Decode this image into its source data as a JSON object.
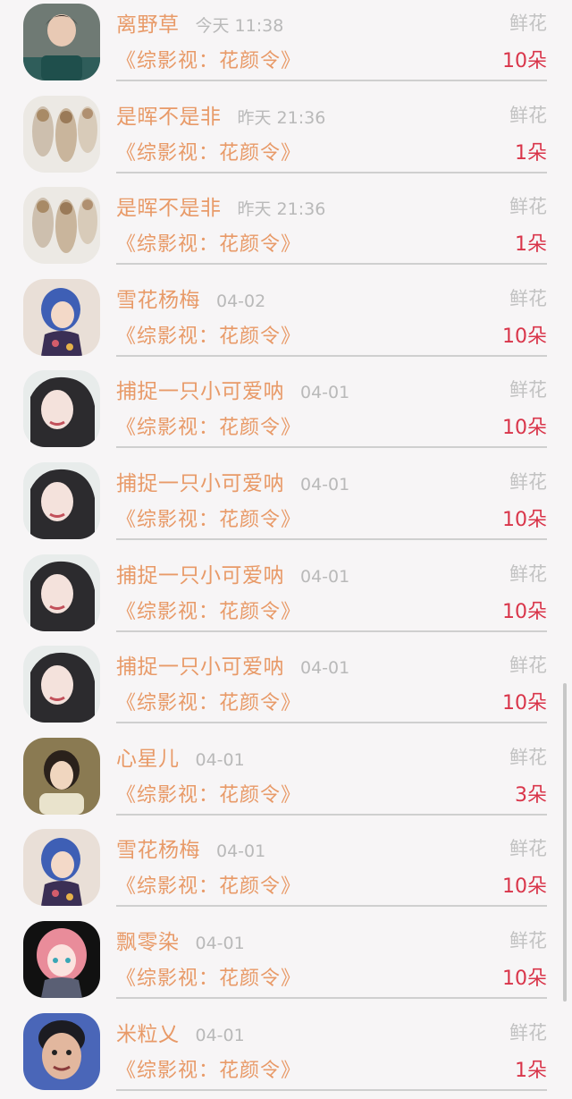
{
  "records": [
    {
      "name": "离野草",
      "time": "今天 11:38",
      "gift_type": "鲜花",
      "book": "《综影视：花颜令》",
      "amount": "10朵",
      "avatar": "avatar-man-money"
    },
    {
      "name": "是晖不是非",
      "time": "昨天 21:36",
      "gift_type": "鲜花",
      "book": "《综影视：花颜令》",
      "amount": "1朵",
      "avatar": "avatar-cats"
    },
    {
      "name": "是晖不是非",
      "time": "昨天 21:36",
      "gift_type": "鲜花",
      "book": "《综影视：花颜令》",
      "amount": "1朵",
      "avatar": "avatar-cats"
    },
    {
      "name": "雪花杨梅",
      "time": "04-02",
      "gift_type": "鲜花",
      "book": "《综影视：花颜令》",
      "amount": "10朵",
      "avatar": "avatar-blue-hair"
    },
    {
      "name": "捕捉一只小可爱呐",
      "time": "04-01",
      "gift_type": "鲜花",
      "book": "《综影视：花颜令》",
      "amount": "10朵",
      "avatar": "avatar-woman-dark-hair"
    },
    {
      "name": "捕捉一只小可爱呐",
      "time": "04-01",
      "gift_type": "鲜花",
      "book": "《综影视：花颜令》",
      "amount": "10朵",
      "avatar": "avatar-woman-dark-hair"
    },
    {
      "name": "捕捉一只小可爱呐",
      "time": "04-01",
      "gift_type": "鲜花",
      "book": "《综影视：花颜令》",
      "amount": "10朵",
      "avatar": "avatar-woman-dark-hair"
    },
    {
      "name": "捕捉一只小可爱呐",
      "time": "04-01",
      "gift_type": "鲜花",
      "book": "《综影视：花颜令》",
      "amount": "10朵",
      "avatar": "avatar-woman-dark-hair"
    },
    {
      "name": "心星儿",
      "time": "04-01",
      "gift_type": "鲜花",
      "book": "《综影视：花颜令》",
      "amount": "3朵",
      "avatar": "avatar-woman-outdoor"
    },
    {
      "name": "雪花杨梅",
      "time": "04-01",
      "gift_type": "鲜花",
      "book": "《综影视：花颜令》",
      "amount": "10朵",
      "avatar": "avatar-blue-hair"
    },
    {
      "name": "飘零染",
      "time": "04-01",
      "gift_type": "鲜花",
      "book": "《综影视：花颜令》",
      "amount": "10朵",
      "avatar": "avatar-pink-hair"
    },
    {
      "name": "米粒乂",
      "time": "04-01",
      "gift_type": "鲜花",
      "book": "《综影视：花颜令》",
      "amount": "1朵",
      "avatar": "avatar-child"
    }
  ],
  "colors": {
    "name": "#e89a68",
    "time": "#b9b9b9",
    "gift_type": "#c2c2c2",
    "amount": "#d9354a",
    "background": "#f7f5f6"
  }
}
